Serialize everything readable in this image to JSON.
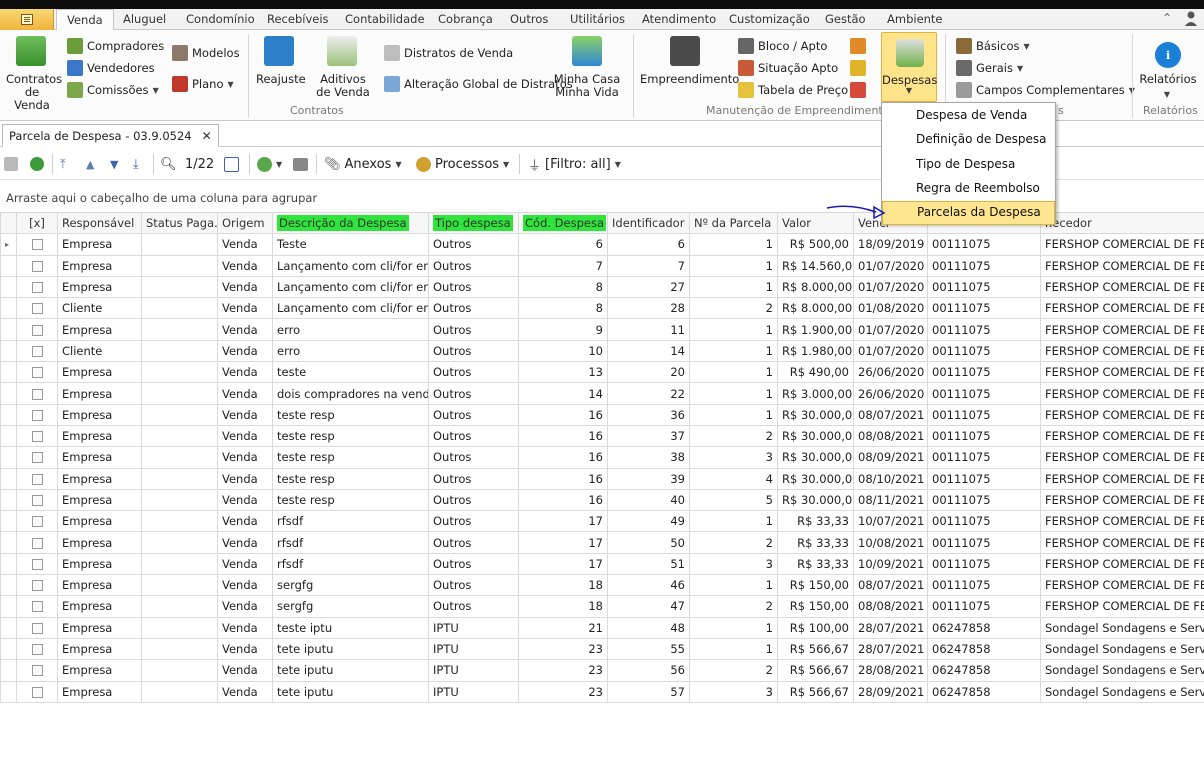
{
  "ribbon_tabs": [
    "Venda",
    "Aluguel",
    "Condomínio",
    "Recebíveis",
    "Contabilidade",
    "Cobrança",
    "Outros",
    "Utilitários",
    "Atendimento",
    "Customização",
    "Gestão",
    "Ambiente"
  ],
  "ribbon": {
    "contratos_venda": "Contratos\nde Venda",
    "compradores": "Compradores",
    "vendedores": "Vendedores",
    "comissoes": "Comissões",
    "modelos": "Modelos",
    "plano": "Plano",
    "reajuste": "Reajuste",
    "aditivos": "Aditivos\nde Venda",
    "distratos": "Distratos de Venda",
    "alteracao_global": "Alteração Global de Distratos",
    "minha_casa": "Minha Casa\nMinha Vida",
    "empreendimento": "Empreendimento",
    "bloco_apto": "Bloco / Apto",
    "situacao_apto": "Situação Apto",
    "tabela_preco": "Tabela de Preço",
    "despesas": "Despesas",
    "basicos": "Básicos",
    "gerais": "Gerais",
    "campos_complementares": "Campos Complementares",
    "relatorios": "Relatórios",
    "group_contratos": "Contratos",
    "group_manutencao": "Manutenção de Empreendimentos",
    "group_s": "s",
    "group_relatorios": "Relatórios"
  },
  "despesas_menu": [
    "Despesa de Venda",
    "Definição de Despesa",
    "Tipo de Despesa",
    "Regra de Reembolso",
    "Parcelas da Despesa"
  ],
  "document_tab": {
    "title": "Parcela de Despesa - 03.9.0524",
    "close": "✕"
  },
  "toolbar": {
    "page_info": "1/22",
    "anexos": "Anexos",
    "processos": "Processos",
    "filtro": "[Filtro: all]"
  },
  "group_hint": "Arraste aqui o cabeçalho de uma coluna para agrupar",
  "columns": [
    "[x]",
    "Responsável",
    "Status Paga...",
    "Origem",
    "Descrição da Despesa",
    "Tipo despesa",
    "Cód. Despesa",
    "Identificador",
    "Nº da Parcela",
    "Valor",
    "Venci",
    "",
    "necedor"
  ],
  "rows": [
    [
      "Empresa",
      "",
      "Venda",
      "Teste",
      "Outros",
      "6",
      "6",
      "1",
      "R$ 500,00",
      "18/09/2019",
      "00111075",
      "FERSHOP COMERCIAL DE FERRA"
    ],
    [
      "Empresa",
      "",
      "Venda",
      "Lançamento com cli/for errado",
      "Outros",
      "7",
      "7",
      "1",
      "R$ 14.560,00",
      "01/07/2020",
      "00111075",
      "FERSHOP COMERCIAL DE FERRA"
    ],
    [
      "Empresa",
      "",
      "Venda",
      "Lançamento com cli/for errado",
      "Outros",
      "8",
      "27",
      "1",
      "R$ 8.000,00",
      "01/07/2020",
      "00111075",
      "FERSHOP COMERCIAL DE FERRA"
    ],
    [
      "Cliente",
      "",
      "Venda",
      "Lançamento com cli/for errado",
      "Outros",
      "8",
      "28",
      "2",
      "R$ 8.000,00",
      "01/08/2020",
      "00111075",
      "FERSHOP COMERCIAL DE FERRA"
    ],
    [
      "Empresa",
      "",
      "Venda",
      "erro",
      "Outros",
      "9",
      "11",
      "1",
      "R$ 1.900,00",
      "01/07/2020",
      "00111075",
      "FERSHOP COMERCIAL DE FERRA"
    ],
    [
      "Cliente",
      "",
      "Venda",
      "erro",
      "Outros",
      "10",
      "14",
      "1",
      "R$ 1.980,00",
      "01/07/2020",
      "00111075",
      "FERSHOP COMERCIAL DE FERRA"
    ],
    [
      "Empresa",
      "",
      "Venda",
      "teste",
      "Outros",
      "13",
      "20",
      "1",
      "R$ 490,00",
      "26/06/2020",
      "00111075",
      "FERSHOP COMERCIAL DE FERRA"
    ],
    [
      "Empresa",
      "",
      "Venda",
      "dois compradores na venda",
      "Outros",
      "14",
      "22",
      "1",
      "R$ 3.000,00",
      "26/06/2020",
      "00111075",
      "FERSHOP COMERCIAL DE FERRA"
    ],
    [
      "Empresa",
      "",
      "Venda",
      "teste resp",
      "Outros",
      "16",
      "36",
      "1",
      "R$ 30.000,00",
      "08/07/2021",
      "00111075",
      "FERSHOP COMERCIAL DE FERRA"
    ],
    [
      "Empresa",
      "",
      "Venda",
      "teste resp",
      "Outros",
      "16",
      "37",
      "2",
      "R$ 30.000,00",
      "08/08/2021",
      "00111075",
      "FERSHOP COMERCIAL DE FERRA"
    ],
    [
      "Empresa",
      "",
      "Venda",
      "teste resp",
      "Outros",
      "16",
      "38",
      "3",
      "R$ 30.000,00",
      "08/09/2021",
      "00111075",
      "FERSHOP COMERCIAL DE FERRA"
    ],
    [
      "Empresa",
      "",
      "Venda",
      "teste resp",
      "Outros",
      "16",
      "39",
      "4",
      "R$ 30.000,00",
      "08/10/2021",
      "00111075",
      "FERSHOP COMERCIAL DE FERRA"
    ],
    [
      "Empresa",
      "",
      "Venda",
      "teste resp",
      "Outros",
      "16",
      "40",
      "5",
      "R$ 30.000,00",
      "08/11/2021",
      "00111075",
      "FERSHOP COMERCIAL DE FERRA"
    ],
    [
      "Empresa",
      "",
      "Venda",
      "rfsdf",
      "Outros",
      "17",
      "49",
      "1",
      "R$ 33,33",
      "10/07/2021",
      "00111075",
      "FERSHOP COMERCIAL DE FERRA"
    ],
    [
      "Empresa",
      "",
      "Venda",
      "rfsdf",
      "Outros",
      "17",
      "50",
      "2",
      "R$ 33,33",
      "10/08/2021",
      "00111075",
      "FERSHOP COMERCIAL DE FERRA"
    ],
    [
      "Empresa",
      "",
      "Venda",
      "rfsdf",
      "Outros",
      "17",
      "51",
      "3",
      "R$ 33,33",
      "10/09/2021",
      "00111075",
      "FERSHOP COMERCIAL DE FERRA"
    ],
    [
      "Empresa",
      "",
      "Venda",
      "sergfg",
      "Outros",
      "18",
      "46",
      "1",
      "R$ 150,00",
      "08/07/2021",
      "00111075",
      "FERSHOP COMERCIAL DE FERRA"
    ],
    [
      "Empresa",
      "",
      "Venda",
      "sergfg",
      "Outros",
      "18",
      "47",
      "2",
      "R$ 150,00",
      "08/08/2021",
      "00111075",
      "FERSHOP COMERCIAL DE FERRA"
    ],
    [
      "Empresa",
      "",
      "Venda",
      "teste iptu",
      "IPTU",
      "21",
      "48",
      "1",
      "R$ 100,00",
      "28/07/2021",
      "06247858",
      "Sondagel Sondagens e Serviços L"
    ],
    [
      "Empresa",
      "",
      "Venda",
      "tete iputu",
      "IPTU",
      "23",
      "55",
      "1",
      "R$ 566,67",
      "28/07/2021",
      "06247858",
      "Sondagel Sondagens e Serviços L"
    ],
    [
      "Empresa",
      "",
      "Venda",
      "tete iputu",
      "IPTU",
      "23",
      "56",
      "2",
      "R$ 566,67",
      "28/08/2021",
      "06247858",
      "Sondagel Sondagens e Serviços L"
    ],
    [
      "Empresa",
      "",
      "Venda",
      "tete iputu",
      "IPTU",
      "23",
      "57",
      "3",
      "R$ 566,67",
      "28/09/2021",
      "06247858",
      "Sondagel Sondagens e Serviços L"
    ]
  ],
  "highlight_color": "#2fe43a"
}
